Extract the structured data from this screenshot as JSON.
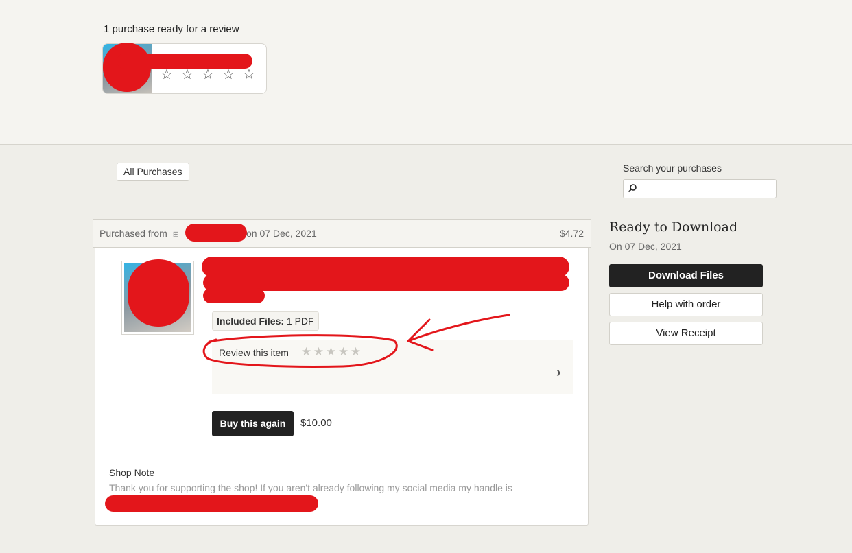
{
  "review_prompt": {
    "heading": "1 purchase ready for a review",
    "stars": [
      "☆",
      "☆",
      "☆",
      "☆",
      "☆"
    ]
  },
  "filters": {
    "all_purchases_label": "All Purchases"
  },
  "search": {
    "label": "Search your purchases",
    "placeholder": "",
    "icon": "search-icon"
  },
  "order": {
    "purchased_from_label": "Purchased from",
    "shop_icon": "shop-icon",
    "date_text": "on 07 Dec, 2021",
    "total": "$4.72",
    "included_files_label": "Included Files:",
    "included_files_value": " 1 PDF",
    "review_label": "Review this item",
    "review_stars": [
      "★",
      "★",
      "★",
      "★",
      "★"
    ],
    "chevron": "›",
    "buy_again_label": "Buy this again",
    "buy_again_price": "$10.00",
    "shop_note_label": "Shop Note",
    "shop_note_text": "Thank you for supporting the shop! If you aren't already following my social media my handle is"
  },
  "download_panel": {
    "title": "Ready to Download",
    "date": "On 07 Dec, 2021",
    "download_label": "Download Files",
    "help_label": "Help with order",
    "receipt_label": "View Receipt"
  },
  "colors": {
    "background": "#efeee9",
    "top_band": "#f5f4f0",
    "dark_button": "#222222",
    "redaction": "#e3161b"
  }
}
